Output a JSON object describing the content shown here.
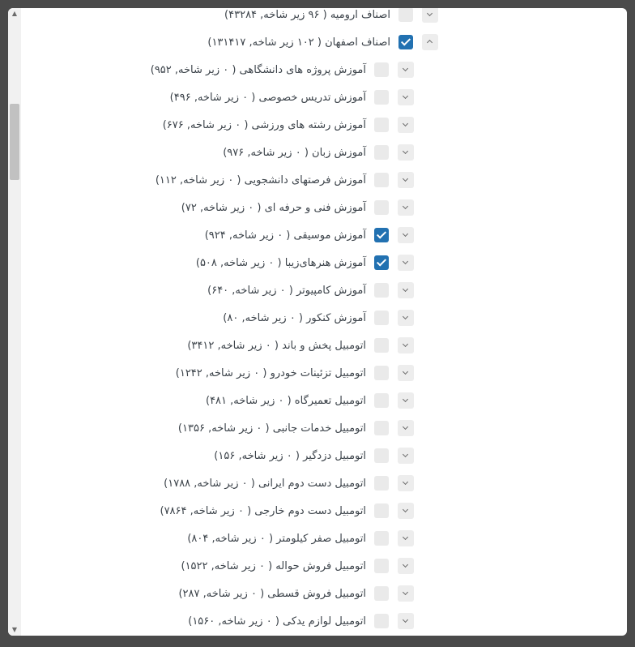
{
  "parents": [
    {
      "label": "اصناف ارومیه ( ۹۶ زیر شاخه, ۴۳۲۸۴)",
      "checked": false,
      "expanded": false
    },
    {
      "label": "اصناف اصفهان ( ۱۰۲ زیر شاخه, ۱۳۱۴۱۷)",
      "checked": true,
      "expanded": true
    }
  ],
  "children": [
    {
      "label": "آموزش پروژه های دانشگاهی ( ۰ زیر شاخه, ۹۵۲)",
      "checked": false
    },
    {
      "label": "آموزش تدریس خصوصی ( ۰ زیر شاخه, ۴۹۶)",
      "checked": false
    },
    {
      "label": "آموزش رشته های ورزشی ( ۰ زیر شاخه, ۶۷۶)",
      "checked": false
    },
    {
      "label": "آموزش زبان ( ۰ زیر شاخه, ۹۷۶)",
      "checked": false
    },
    {
      "label": "آموزش فرصتهای دانشجویی ( ۰ زیر شاخه, ۱۱۲)",
      "checked": false
    },
    {
      "label": "آموزش فنی و حرفه ای ( ۰ زیر شاخه, ۷۲)",
      "checked": false
    },
    {
      "label": "آموزش موسیقی ( ۰ زیر شاخه, ۹۲۴)",
      "checked": true
    },
    {
      "label": "آموزش هنرهای‌زیبا ( ۰ زیر شاخه, ۵۰۸)",
      "checked": true
    },
    {
      "label": "آموزش کامپیوتر ( ۰ زیر شاخه, ۶۴۰)",
      "checked": false
    },
    {
      "label": "آموزش کنکور ( ۰ زیر شاخه, ۸۰)",
      "checked": false
    },
    {
      "label": "اتومبیل پخش و باند ( ۰ زیر شاخه, ۳۴۱۲)",
      "checked": false
    },
    {
      "label": "اتومبیل تزئینات خودرو ( ۰ زیر شاخه, ۱۲۴۲)",
      "checked": false
    },
    {
      "label": "اتومبیل تعمیرگاه ( ۰ زیر شاخه, ۴۸۱)",
      "checked": false
    },
    {
      "label": "اتومبیل خدمات جانبی ( ۰ زیر شاخه, ۱۳۵۶)",
      "checked": false
    },
    {
      "label": "اتومبیل دزدگیر ( ۰ زیر شاخه, ۱۵۶)",
      "checked": false
    },
    {
      "label": "اتومبیل دست دوم ایرانی ( ۰ زیر شاخه, ۱۷۸۸)",
      "checked": false
    },
    {
      "label": "اتومبیل دست دوم خارجی ( ۰ زیر شاخه, ۷۸۶۴)",
      "checked": false
    },
    {
      "label": "اتومبیل صفر کیلومتر ( ۰ زیر شاخه, ۸۰۴)",
      "checked": false
    },
    {
      "label": "اتومبیل فروش حواله ( ۰ زیر شاخه, ۱۵۲۲)",
      "checked": false
    },
    {
      "label": "اتومبیل فروش قسطی ( ۰ زیر شاخه, ۲۸۷)",
      "checked": false
    },
    {
      "label": "اتومبیل لوازم یدکی ( ۰ زیر شاخه, ۱۵۶۰)",
      "checked": false
    }
  ]
}
